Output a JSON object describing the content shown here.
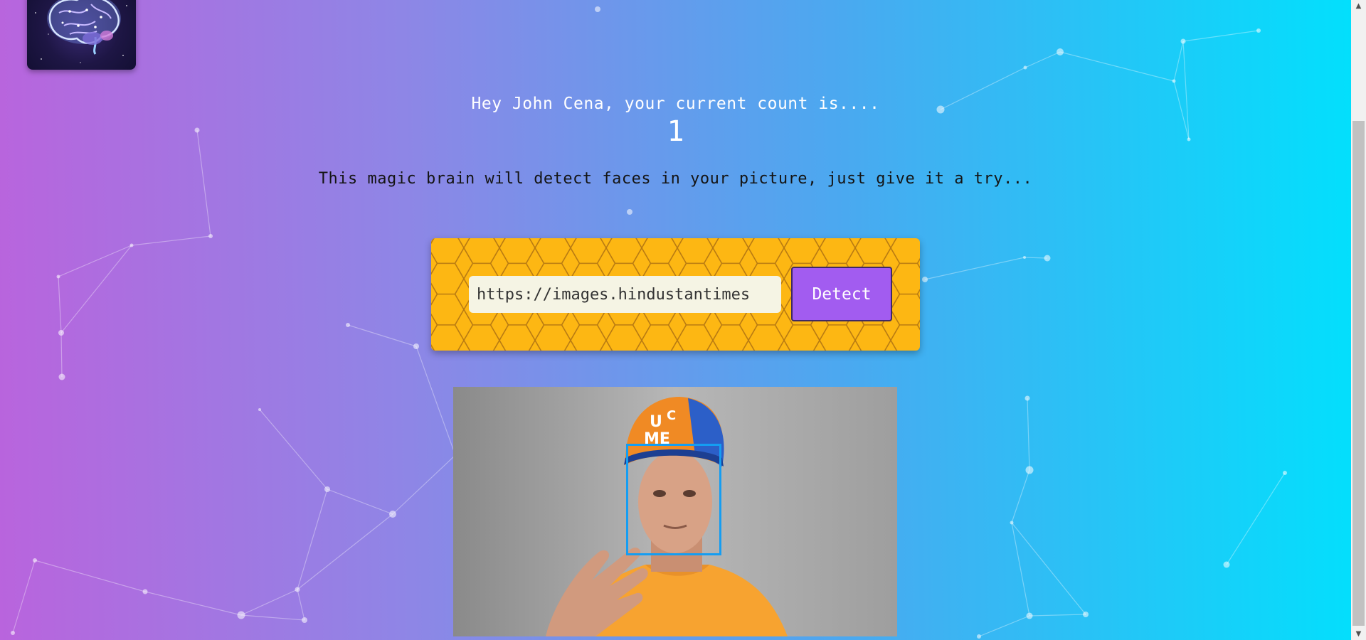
{
  "logo": {
    "icon": "brain-icon"
  },
  "greeting": "Hey John Cena, your current count is....",
  "count": "1",
  "subtitle": "This magic brain will detect faces in your picture, just give it a try...",
  "form": {
    "url_value": "https://images.hindustantimes",
    "detect_label": "Detect"
  },
  "photo": {
    "icon": "face-photo"
  },
  "colors": {
    "gradient_start": "#b964dd",
    "gradient_end": "#00e1fd",
    "panel": "#fdb713",
    "button": "#a25cf0",
    "face_box": "#149df2"
  },
  "scrollbar": {
    "up_icon": "triangle-up-icon",
    "down_icon": "triangle-down-icon"
  }
}
